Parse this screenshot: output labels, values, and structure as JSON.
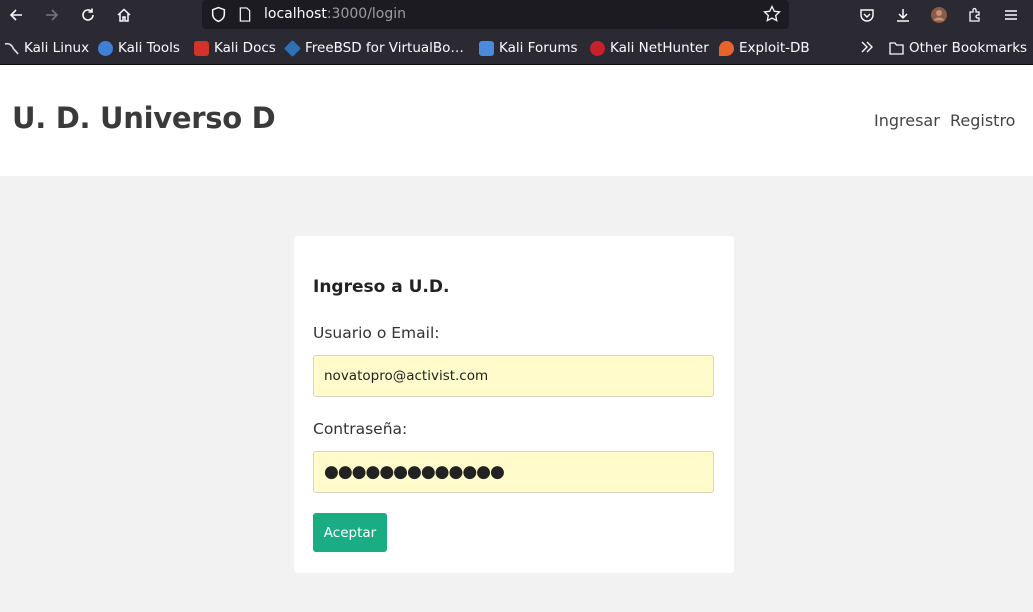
{
  "browser": {
    "url_host": "localhost",
    "url_rest": ":3000/login",
    "icons": [
      "back-icon",
      "forward-icon",
      "reload-icon",
      "home-icon",
      "shield-icon",
      "page-icon",
      "star-icon",
      "pocket-icon",
      "download-icon",
      "account-icon",
      "extensions-icon",
      "menu-icon"
    ]
  },
  "bookmarks": {
    "items": [
      "Kali Linux",
      "Kali Tools",
      "Kali Docs",
      "FreeBSD for VirtualBo…",
      "Kali Forums",
      "Kali NetHunter",
      "Exploit-DB"
    ],
    "overflow_icon": "chevrons-right-icon",
    "other": "Other Bookmarks"
  },
  "site": {
    "brand": "U. D. Universo D",
    "nav": {
      "login": "Ingresar",
      "register": "Registro"
    }
  },
  "login": {
    "title": "Ingreso a U.D.",
    "user_label": "Usuario o Email:",
    "user_value": "novatopro@activist.com",
    "password_label": "Contraseña:",
    "password_value": "●●●●●●●●●●●●●",
    "submit_label": "Aceptar"
  },
  "colors": {
    "accent": "#1aad84",
    "autofill": "#fffbca",
    "browser_chrome": "#2b2a33",
    "page_bg": "#f2f2f3"
  }
}
